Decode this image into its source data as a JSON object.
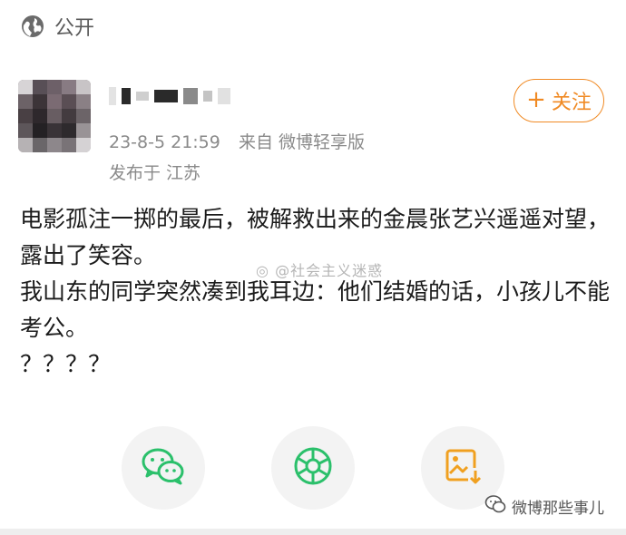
{
  "header": {
    "visibility_icon": "globe-icon",
    "visibility_label": "公开"
  },
  "author": {
    "name_obscured": true,
    "timestamp": "23-8-5 21:59",
    "source": "来自 微博轻享版",
    "location": "发布于 江苏",
    "follow_label": "关注",
    "follow_plus": "+"
  },
  "post": {
    "lines": [
      "电影孤注一掷的最后，被解救出来的金晨张艺兴遥遥对望，露出了笑容。",
      "我山东的同学突然凑到我耳边：他们结婚的话，小孩儿不能考公。",
      "？？？？"
    ],
    "watermark": "@社会主义迷惑"
  },
  "share": {
    "wechat_icon": "wechat-icon",
    "moments_icon": "moments-icon",
    "save_image_icon": "save-image-icon"
  },
  "footer": {
    "credit": "微博那些事儿"
  },
  "colors": {
    "accent": "#f08a24",
    "wechat_green": "#2bc06b",
    "save_orange": "#f0a020"
  }
}
